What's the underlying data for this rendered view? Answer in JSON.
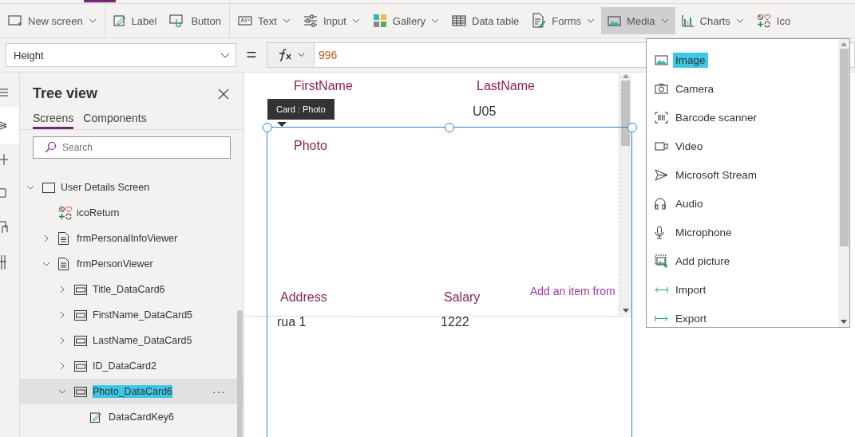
{
  "toolbar": {
    "items": [
      {
        "label": "New screen",
        "kind": "screen",
        "has_menu": true,
        "selected": false
      },
      {
        "label": "Label",
        "kind": "label",
        "has_menu": false,
        "selected": false
      },
      {
        "label": "Button",
        "kind": "button",
        "has_menu": false,
        "selected": false
      },
      {
        "label": "Text",
        "kind": "text",
        "has_menu": true,
        "selected": false
      },
      {
        "label": "Input",
        "kind": "input",
        "has_menu": true,
        "selected": false
      },
      {
        "label": "Gallery",
        "kind": "gallery",
        "has_menu": true,
        "selected": false
      },
      {
        "label": "Data table",
        "kind": "table",
        "has_menu": false,
        "selected": false
      },
      {
        "label": "Forms",
        "kind": "forms",
        "has_menu": true,
        "selected": false
      },
      {
        "label": "Media",
        "kind": "media",
        "has_menu": true,
        "selected": true
      },
      {
        "label": "Charts",
        "kind": "charts",
        "has_menu": true,
        "selected": false
      },
      {
        "label": "Ico",
        "kind": "icons",
        "has_menu": false,
        "selected": false
      }
    ]
  },
  "formula_bar": {
    "property": "Height",
    "equals": "=",
    "formula": "996"
  },
  "tree_view": {
    "title": "Tree view",
    "tabs": [
      {
        "label": "Screens",
        "selected": true
      },
      {
        "label": "Components",
        "selected": false
      }
    ],
    "search": {
      "placeholder": "Search"
    },
    "items": [
      {
        "label": "User Details Screen",
        "kind": "screen",
        "expanded": true,
        "selected": false,
        "highlighted": false,
        "children": [
          {
            "label": "icoReturn",
            "kind": "icons",
            "selected": false,
            "highlighted": false
          },
          {
            "label": "frmPersonalInfoViewer",
            "kind": "form",
            "expanded": false,
            "selected": false,
            "highlighted": false
          },
          {
            "label": "frmPersonViewer",
            "kind": "form",
            "expanded": true,
            "selected": false,
            "highlighted": false,
            "children": [
              {
                "label": "Title_DataCard6",
                "kind": "card",
                "expanded": false,
                "selected": false,
                "highlighted": false
              },
              {
                "label": "FirstName_DataCard5",
                "kind": "card",
                "expanded": false,
                "selected": false,
                "highlighted": false
              },
              {
                "label": "LastName_DataCard5",
                "kind": "card",
                "expanded": false,
                "selected": false,
                "highlighted": false
              },
              {
                "label": "ID_DataCard2",
                "kind": "card",
                "expanded": false,
                "selected": false,
                "highlighted": false
              },
              {
                "label": "Photo_DataCard6",
                "kind": "card",
                "expanded": true,
                "selected": true,
                "highlighted": true,
                "more": "···",
                "children": [
                  {
                    "label": "DataCardKey6",
                    "kind": "edit",
                    "selected": false,
                    "highlighted": false
                  }
                ]
              }
            ]
          }
        ]
      }
    ]
  },
  "canvas": {
    "tooltip": "Card : Photo",
    "fields": [
      {
        "kind": "label",
        "text": "FirstName"
      },
      {
        "kind": "label",
        "text": "LastName"
      },
      {
        "kind": "value",
        "text": "U05"
      },
      {
        "kind": "label",
        "text": "Photo"
      },
      {
        "kind": "label",
        "text": "Address"
      },
      {
        "kind": "label",
        "text": "Salary"
      },
      {
        "kind": "hint",
        "text": "Add an item from"
      },
      {
        "kind": "value",
        "text": "rua 1"
      },
      {
        "kind": "value",
        "text": "1222"
      }
    ]
  },
  "media_menu": {
    "items": [
      {
        "label": "Image",
        "kind": "image",
        "highlighted": true
      },
      {
        "label": "Camera",
        "kind": "camera",
        "highlighted": false
      },
      {
        "label": "Barcode scanner",
        "kind": "barcode",
        "highlighted": false
      },
      {
        "label": "Video",
        "kind": "video",
        "highlighted": false
      },
      {
        "label": "Microsoft Stream",
        "kind": "stream",
        "highlighted": false
      },
      {
        "label": "Audio",
        "kind": "audio",
        "highlighted": false
      },
      {
        "label": "Microphone",
        "kind": "microphone",
        "highlighted": false
      },
      {
        "label": "Add picture",
        "kind": "addpicture",
        "highlighted": false
      },
      {
        "label": "Import",
        "kind": "import",
        "highlighted": false
      },
      {
        "label": "Export",
        "kind": "export",
        "highlighted": false
      }
    ]
  }
}
